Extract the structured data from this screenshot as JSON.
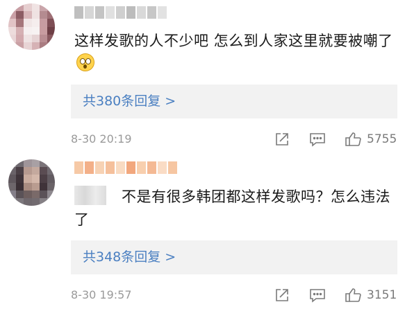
{
  "comments": [
    {
      "text": "这样发歌的人不少吧 怎么到人家这里就要被嘲了",
      "replies_label": "共380条回复 >",
      "time": "8-30 20:19",
      "likes": "5755",
      "avatar_colors": [
        "#d9b6b8",
        "#c89ea4",
        "#e6cfd0",
        "#f0e3e3",
        "#c9a5aa",
        "#b78b92",
        "#caa0a6",
        "#8c5c63",
        "#d8b6b9",
        "#efe2e2",
        "#b48b90",
        "#9e6f75",
        "#e1c3c5",
        "#a5767b",
        "#f1e6e6",
        "#f5eded",
        "#c79ca1",
        "#7e4e55",
        "#eddcdc",
        "#d5b0b3",
        "#f6f0f0",
        "#f7f2f2",
        "#c89ca0",
        "#6e3f46",
        "#e9d6d7",
        "#d2a9ad",
        "#efe3e3",
        "#e6d3d4",
        "#b98d92",
        "#8a5a60",
        "#dcbfc1",
        "#c9a0a4",
        "#e8d4d5",
        "#d6b2b5",
        "#a97c81",
        "#9a6a70"
      ],
      "name_colors": [
        "#bfbfbf",
        "#d6d6d6",
        "#c4c4c4",
        "#e0e0e0",
        "#cfcfcf",
        "#bcbcbc",
        "#d9d9d9",
        "#c7c7c7",
        "#e2e2e2"
      ]
    },
    {
      "text": "不是有很多韩团都这样发歌吗？怎么违法了",
      "replies_label": "共348条回复 >",
      "time": "8-30 19:57",
      "likes": "3151",
      "avatar_colors": [
        "#8f8a8e",
        "#6f6a70",
        "#9f959a",
        "#a8a0a4",
        "#7b7479",
        "#8a8388",
        "#6a6369",
        "#4a3f45",
        "#b69a90",
        "#c4a99e",
        "#5a4c52",
        "#706a70",
        "#5f575d",
        "#3f343a",
        "#c9ac9f",
        "#d4b8ab",
        "#4c3f45",
        "#625b61",
        "#6d666b",
        "#3a2f35",
        "#a88b80",
        "#b99c90",
        "#3f3339",
        "#6a6368",
        "#85808a",
        "#5a5257",
        "#6d5e5e",
        "#7a6a69",
        "#5b5258",
        "#8d888e",
        "#9a969b",
        "#7c777c",
        "#6f686d",
        "#726b70",
        "#858085",
        "#a29ea2"
      ],
      "name_colors": [
        "#f6c9a6",
        "#f3b089",
        "#f7d2b4",
        "#f5c09c",
        "#f9dbc2",
        "#f2a77d",
        "#f8cfae",
        "#f4b994",
        "#fadcc5",
        "#f6c6a2"
      ]
    }
  ],
  "icons": [
    "share-icon",
    "comment-icon",
    "like-icon"
  ]
}
